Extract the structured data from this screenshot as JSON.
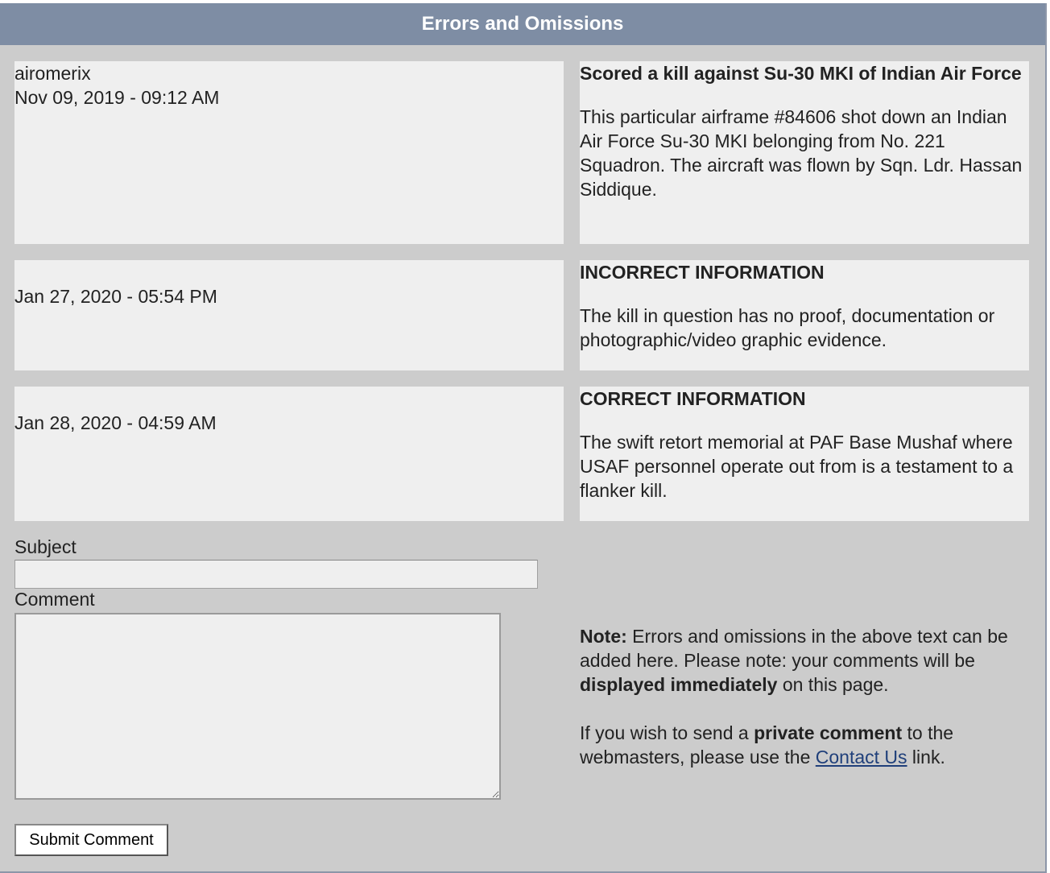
{
  "header": {
    "title": "Errors and Omissions"
  },
  "entries": [
    {
      "author": "airomerix",
      "date": "Nov 09, 2019 - 09:12 AM",
      "subject": "Scored a kill against Su-30 MKI of Indian Air Force",
      "body": "This particular airframe #84606 shot down an Indian Air Force Su-30 MKI belonging from No. 221 Squadron. The aircraft was flown by Sqn. Ldr. Hassan Siddique."
    },
    {
      "author": "",
      "date": "Jan 27, 2020 - 05:54 PM",
      "subject": "INCORRECT INFORMATION",
      "body": "The kill in question has no proof, documentation or photographic/video graphic evidence."
    },
    {
      "author": "",
      "date": "Jan 28, 2020 - 04:59 AM",
      "subject": "CORRECT INFORMATION",
      "body": "The swift retort memorial at PAF Base Mushaf where USAF personnel operate out from is a testament to a flanker kill."
    }
  ],
  "form": {
    "subject_label": "Subject",
    "subject_value": "",
    "comment_label": "Comment",
    "comment_value": "",
    "submit_label": "Submit Comment"
  },
  "note": {
    "note_label": "Note:",
    "text1": " Errors and omissions in the above text can be added here. Please note: your comments will be ",
    "bold1": "displayed immediately",
    "text2": " on this page.",
    "text3": "If you wish to send a ",
    "bold2": "private comment",
    "text4": " to the webmasters, please use the ",
    "link_label": "Contact Us",
    "text5": " link."
  },
  "colors": {
    "header_bg": "#7e8da4",
    "panel_bg": "#cccccc",
    "cell_bg": "#efefef",
    "link": "#1f3f7a"
  }
}
